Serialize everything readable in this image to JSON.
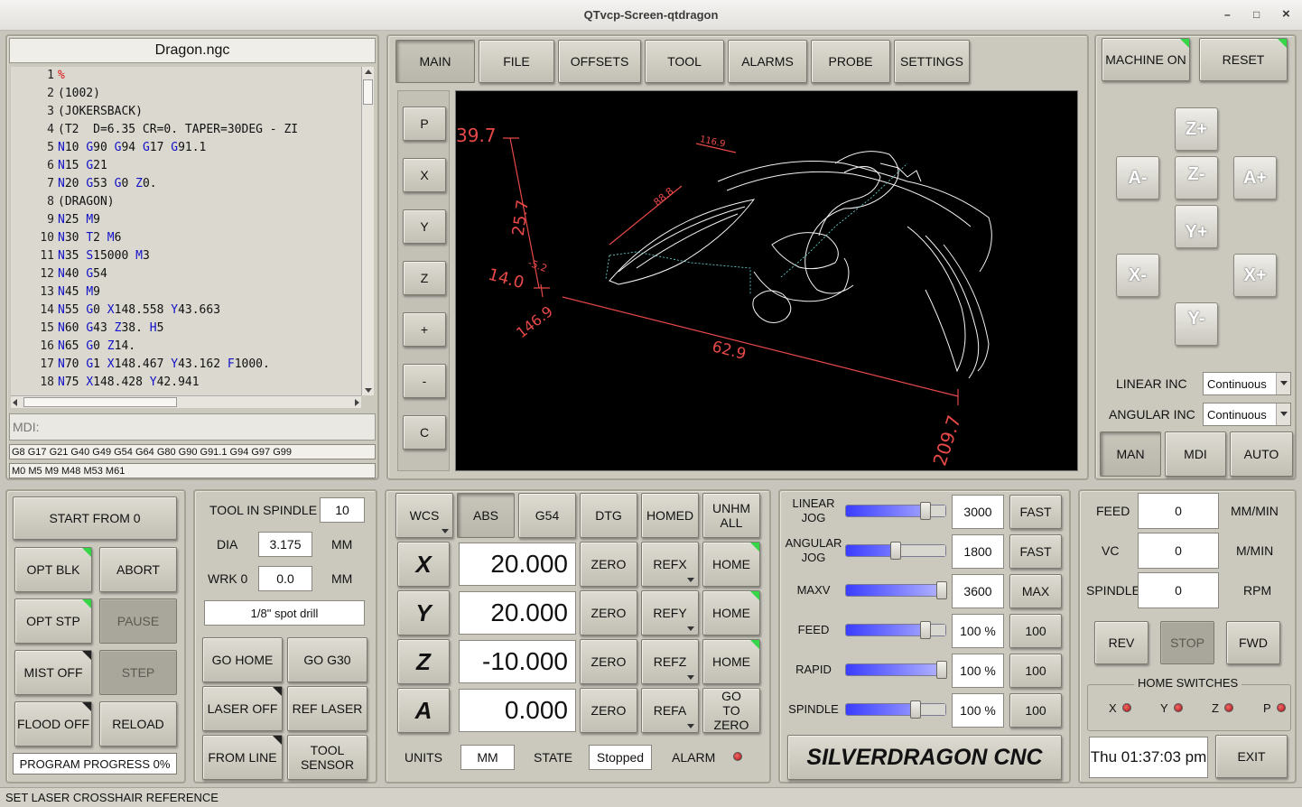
{
  "window": {
    "title": "QTvcp-Screen-qtdragon",
    "minimize": "–",
    "maximize": "□",
    "close": "×"
  },
  "gcode": {
    "filename": "Dragon.ngc",
    "mdi_label": "MDI:",
    "active_gcodes": "G8 G17 G21 G40 G49 G54 G64 G80 G90 G91.1 G94 G97 G99",
    "active_mcodes": "M0 M5 M9 M48 M53 M61",
    "lines": [
      {
        "n": "1",
        "parts": [
          {
            "t": "%",
            "c": "r"
          }
        ]
      },
      {
        "n": "2",
        "parts": [
          {
            "t": "(1002)",
            "c": ""
          }
        ]
      },
      {
        "n": "3",
        "parts": [
          {
            "t": "(JOKERSBACK)",
            "c": ""
          }
        ]
      },
      {
        "n": "4",
        "parts": [
          {
            "t": "(T2  D=6.35 CR=0. TAPER=30DEG - ZI",
            "c": ""
          }
        ]
      },
      {
        "n": "5",
        "parts": [
          {
            "t": "N",
            "c": "b"
          },
          {
            "t": "10 ",
            "c": ""
          },
          {
            "t": "G",
            "c": "b"
          },
          {
            "t": "90 ",
            "c": ""
          },
          {
            "t": "G",
            "c": "b"
          },
          {
            "t": "94 ",
            "c": ""
          },
          {
            "t": "G",
            "c": "b"
          },
          {
            "t": "17 ",
            "c": ""
          },
          {
            "t": "G",
            "c": "b"
          },
          {
            "t": "91.1",
            "c": ""
          }
        ]
      },
      {
        "n": "6",
        "parts": [
          {
            "t": "N",
            "c": "b"
          },
          {
            "t": "15 ",
            "c": ""
          },
          {
            "t": "G",
            "c": "b"
          },
          {
            "t": "21",
            "c": ""
          }
        ]
      },
      {
        "n": "7",
        "parts": [
          {
            "t": "N",
            "c": "b"
          },
          {
            "t": "20 ",
            "c": ""
          },
          {
            "t": "G",
            "c": "b"
          },
          {
            "t": "53 ",
            "c": ""
          },
          {
            "t": "G",
            "c": "b"
          },
          {
            "t": "0 ",
            "c": ""
          },
          {
            "t": "Z",
            "c": "b"
          },
          {
            "t": "0.",
            "c": ""
          }
        ]
      },
      {
        "n": "8",
        "parts": [
          {
            "t": "(DRAGON)",
            "c": ""
          }
        ]
      },
      {
        "n": "9",
        "parts": [
          {
            "t": "N",
            "c": "b"
          },
          {
            "t": "25 ",
            "c": ""
          },
          {
            "t": "M",
            "c": "b"
          },
          {
            "t": "9",
            "c": ""
          }
        ]
      },
      {
        "n": "10",
        "parts": [
          {
            "t": "N",
            "c": "b"
          },
          {
            "t": "30 ",
            "c": ""
          },
          {
            "t": "T",
            "c": "b"
          },
          {
            "t": "2 ",
            "c": ""
          },
          {
            "t": "M",
            "c": "b"
          },
          {
            "t": "6",
            "c": ""
          }
        ]
      },
      {
        "n": "11",
        "parts": [
          {
            "t": "N",
            "c": "b"
          },
          {
            "t": "35 ",
            "c": ""
          },
          {
            "t": "S",
            "c": "b"
          },
          {
            "t": "15000 ",
            "c": ""
          },
          {
            "t": "M",
            "c": "b"
          },
          {
            "t": "3",
            "c": ""
          }
        ]
      },
      {
        "n": "12",
        "parts": [
          {
            "t": "N",
            "c": "b"
          },
          {
            "t": "40 ",
            "c": ""
          },
          {
            "t": "G",
            "c": "b"
          },
          {
            "t": "54",
            "c": ""
          }
        ]
      },
      {
        "n": "13",
        "parts": [
          {
            "t": "N",
            "c": "b"
          },
          {
            "t": "45 ",
            "c": ""
          },
          {
            "t": "M",
            "c": "b"
          },
          {
            "t": "9",
            "c": ""
          }
        ]
      },
      {
        "n": "14",
        "parts": [
          {
            "t": "N",
            "c": "b"
          },
          {
            "t": "55 ",
            "c": ""
          },
          {
            "t": "G",
            "c": "b"
          },
          {
            "t": "0 ",
            "c": ""
          },
          {
            "t": "X",
            "c": "b"
          },
          {
            "t": "148.558 ",
            "c": ""
          },
          {
            "t": "Y",
            "c": "b"
          },
          {
            "t": "43.663",
            "c": ""
          }
        ]
      },
      {
        "n": "15",
        "parts": [
          {
            "t": "N",
            "c": "b"
          },
          {
            "t": "60 ",
            "c": ""
          },
          {
            "t": "G",
            "c": "b"
          },
          {
            "t": "43 ",
            "c": ""
          },
          {
            "t": "Z",
            "c": "b"
          },
          {
            "t": "38. ",
            "c": ""
          },
          {
            "t": "H",
            "c": "b"
          },
          {
            "t": "5",
            "c": ""
          }
        ]
      },
      {
        "n": "16",
        "parts": [
          {
            "t": "N",
            "c": "b"
          },
          {
            "t": "65 ",
            "c": ""
          },
          {
            "t": "G",
            "c": "b"
          },
          {
            "t": "0 ",
            "c": ""
          },
          {
            "t": "Z",
            "c": "b"
          },
          {
            "t": "14.",
            "c": ""
          }
        ]
      },
      {
        "n": "17",
        "parts": [
          {
            "t": "N",
            "c": "b"
          },
          {
            "t": "70 ",
            "c": ""
          },
          {
            "t": "G",
            "c": "b"
          },
          {
            "t": "1 ",
            "c": ""
          },
          {
            "t": "X",
            "c": "b"
          },
          {
            "t": "148.467 ",
            "c": ""
          },
          {
            "t": "Y",
            "c": "b"
          },
          {
            "t": "43.162 ",
            "c": ""
          },
          {
            "t": "F",
            "c": "b"
          },
          {
            "t": "1000.",
            "c": ""
          }
        ]
      },
      {
        "n": "18",
        "parts": [
          {
            "t": "N",
            "c": "b"
          },
          {
            "t": "75 ",
            "c": ""
          },
          {
            "t": "X",
            "c": "b"
          },
          {
            "t": "148.428 ",
            "c": ""
          },
          {
            "t": "Y",
            "c": "b"
          },
          {
            "t": "42.941",
            "c": ""
          }
        ]
      }
    ]
  },
  "tabs": [
    "MAIN",
    "FILE",
    "OFFSETS",
    "TOOL",
    "ALARMS",
    "PROBE",
    "SETTINGS"
  ],
  "view_buttons": [
    "P",
    "X",
    "Y",
    "Z",
    "+",
    "-",
    "C"
  ],
  "preview": {
    "dims": [
      "39.7",
      "25.7",
      "14.0",
      "146.9",
      "62.9",
      "209.7",
      "116.9",
      "88.8",
      "-5.2"
    ]
  },
  "machine": {
    "machine_on": "MACHINE ON",
    "reset": "RESET",
    "jog": {
      "z_plus": "Z+",
      "z_minus": "Z-",
      "a_minus": "A-",
      "a_plus": "A+",
      "y_plus": "Y+",
      "y_minus": "Y-",
      "x_minus": "X-",
      "x_plus": "X+"
    },
    "linear_inc_label": "LINEAR INC",
    "linear_inc": "Continuous",
    "angular_inc_label": "ANGULAR INC",
    "angular_inc": "Continuous",
    "modes": [
      "MAN",
      "MDI",
      "AUTO"
    ]
  },
  "run": {
    "start_from": "START FROM 0",
    "opt_blk": "OPT BLK",
    "abort": "ABORT",
    "opt_stp": "OPT STP",
    "pause": "PAUSE",
    "mist": "MIST OFF",
    "step": "STEP",
    "flood": "FLOOD OFF",
    "reload": "RELOAD",
    "progress": "PROGRAM PROGRESS 0%",
    "progress_value": 0
  },
  "tool": {
    "tool_in_spindle_label": "TOOL IN SPINDLE",
    "tool_in_spindle": "10",
    "dia_label": "DIA",
    "dia": "3.175",
    "dia_unit": "MM",
    "wrk_label": "WRK 0",
    "wrk": "0.0",
    "wrk_unit": "MM",
    "desc": "1/8\" spot drill",
    "go_home": "GO HOME",
    "go_g30": "GO G30",
    "laser_off": "LASER OFF",
    "ref_laser": "REF LASER",
    "from_line": "FROM LINE",
    "tool_sensor": "TOOL SENSOR"
  },
  "dro": {
    "wcs": "WCS",
    "abs": "ABS",
    "g54": "G54",
    "dtg": "DTG",
    "homed": "HOMED",
    "unhome_all": "UNHM ALL",
    "axes": [
      {
        "name": "X",
        "value": "20.000",
        "zero": "ZERO",
        "ref": "REFX",
        "home": "HOME"
      },
      {
        "name": "Y",
        "value": "20.000",
        "zero": "ZERO",
        "ref": "REFY",
        "home": "HOME"
      },
      {
        "name": "Z",
        "value": "-10.000",
        "zero": "ZERO",
        "ref": "REFZ",
        "home": "HOME"
      },
      {
        "name": "A",
        "value": "0.000",
        "zero": "ZERO",
        "ref": "REFA",
        "home": "GO TO ZERO"
      }
    ],
    "units_label": "UNITS",
    "units": "MM",
    "state_label": "STATE",
    "state": "Stopped",
    "alarm_label": "ALARM"
  },
  "rates": [
    {
      "label": "LINEAR JOG",
      "value": "3000",
      "btn": "FAST",
      "pos": 0.8
    },
    {
      "label": "ANGULAR JOG",
      "value": "1800",
      "btn": "FAST",
      "pos": 0.5
    },
    {
      "label": "MAXV",
      "value": "3600",
      "btn": "MAX",
      "pos": 0.96
    },
    {
      "label": "FEED",
      "value": "100 %",
      "btn": "100",
      "pos": 0.8
    },
    {
      "label": "RAPID",
      "value": "100 %",
      "btn": "100",
      "pos": 0.96
    },
    {
      "label": "SPINDLE",
      "value": "100 %",
      "btn": "100",
      "pos": 0.7
    }
  ],
  "brand": "SILVERDRAGON CNC",
  "status": {
    "feed_label": "FEED",
    "feed": "0",
    "feed_unit": "MM/MIN",
    "vc_label": "VC",
    "vc": "0",
    "vc_unit": "M/MIN",
    "spindle_label": "SPINDLE",
    "spindle": "0",
    "spindle_unit": "RPM",
    "rev": "REV",
    "stop": "STOP",
    "fwd": "FWD",
    "home_switches": "HOME SWITCHES",
    "switches": [
      "X",
      "Y",
      "Z",
      "P"
    ],
    "clock": "Thu 01:37:03 pm",
    "exit": "EXIT"
  },
  "statusbar": "SET LASER CROSSHAIR REFERENCE"
}
